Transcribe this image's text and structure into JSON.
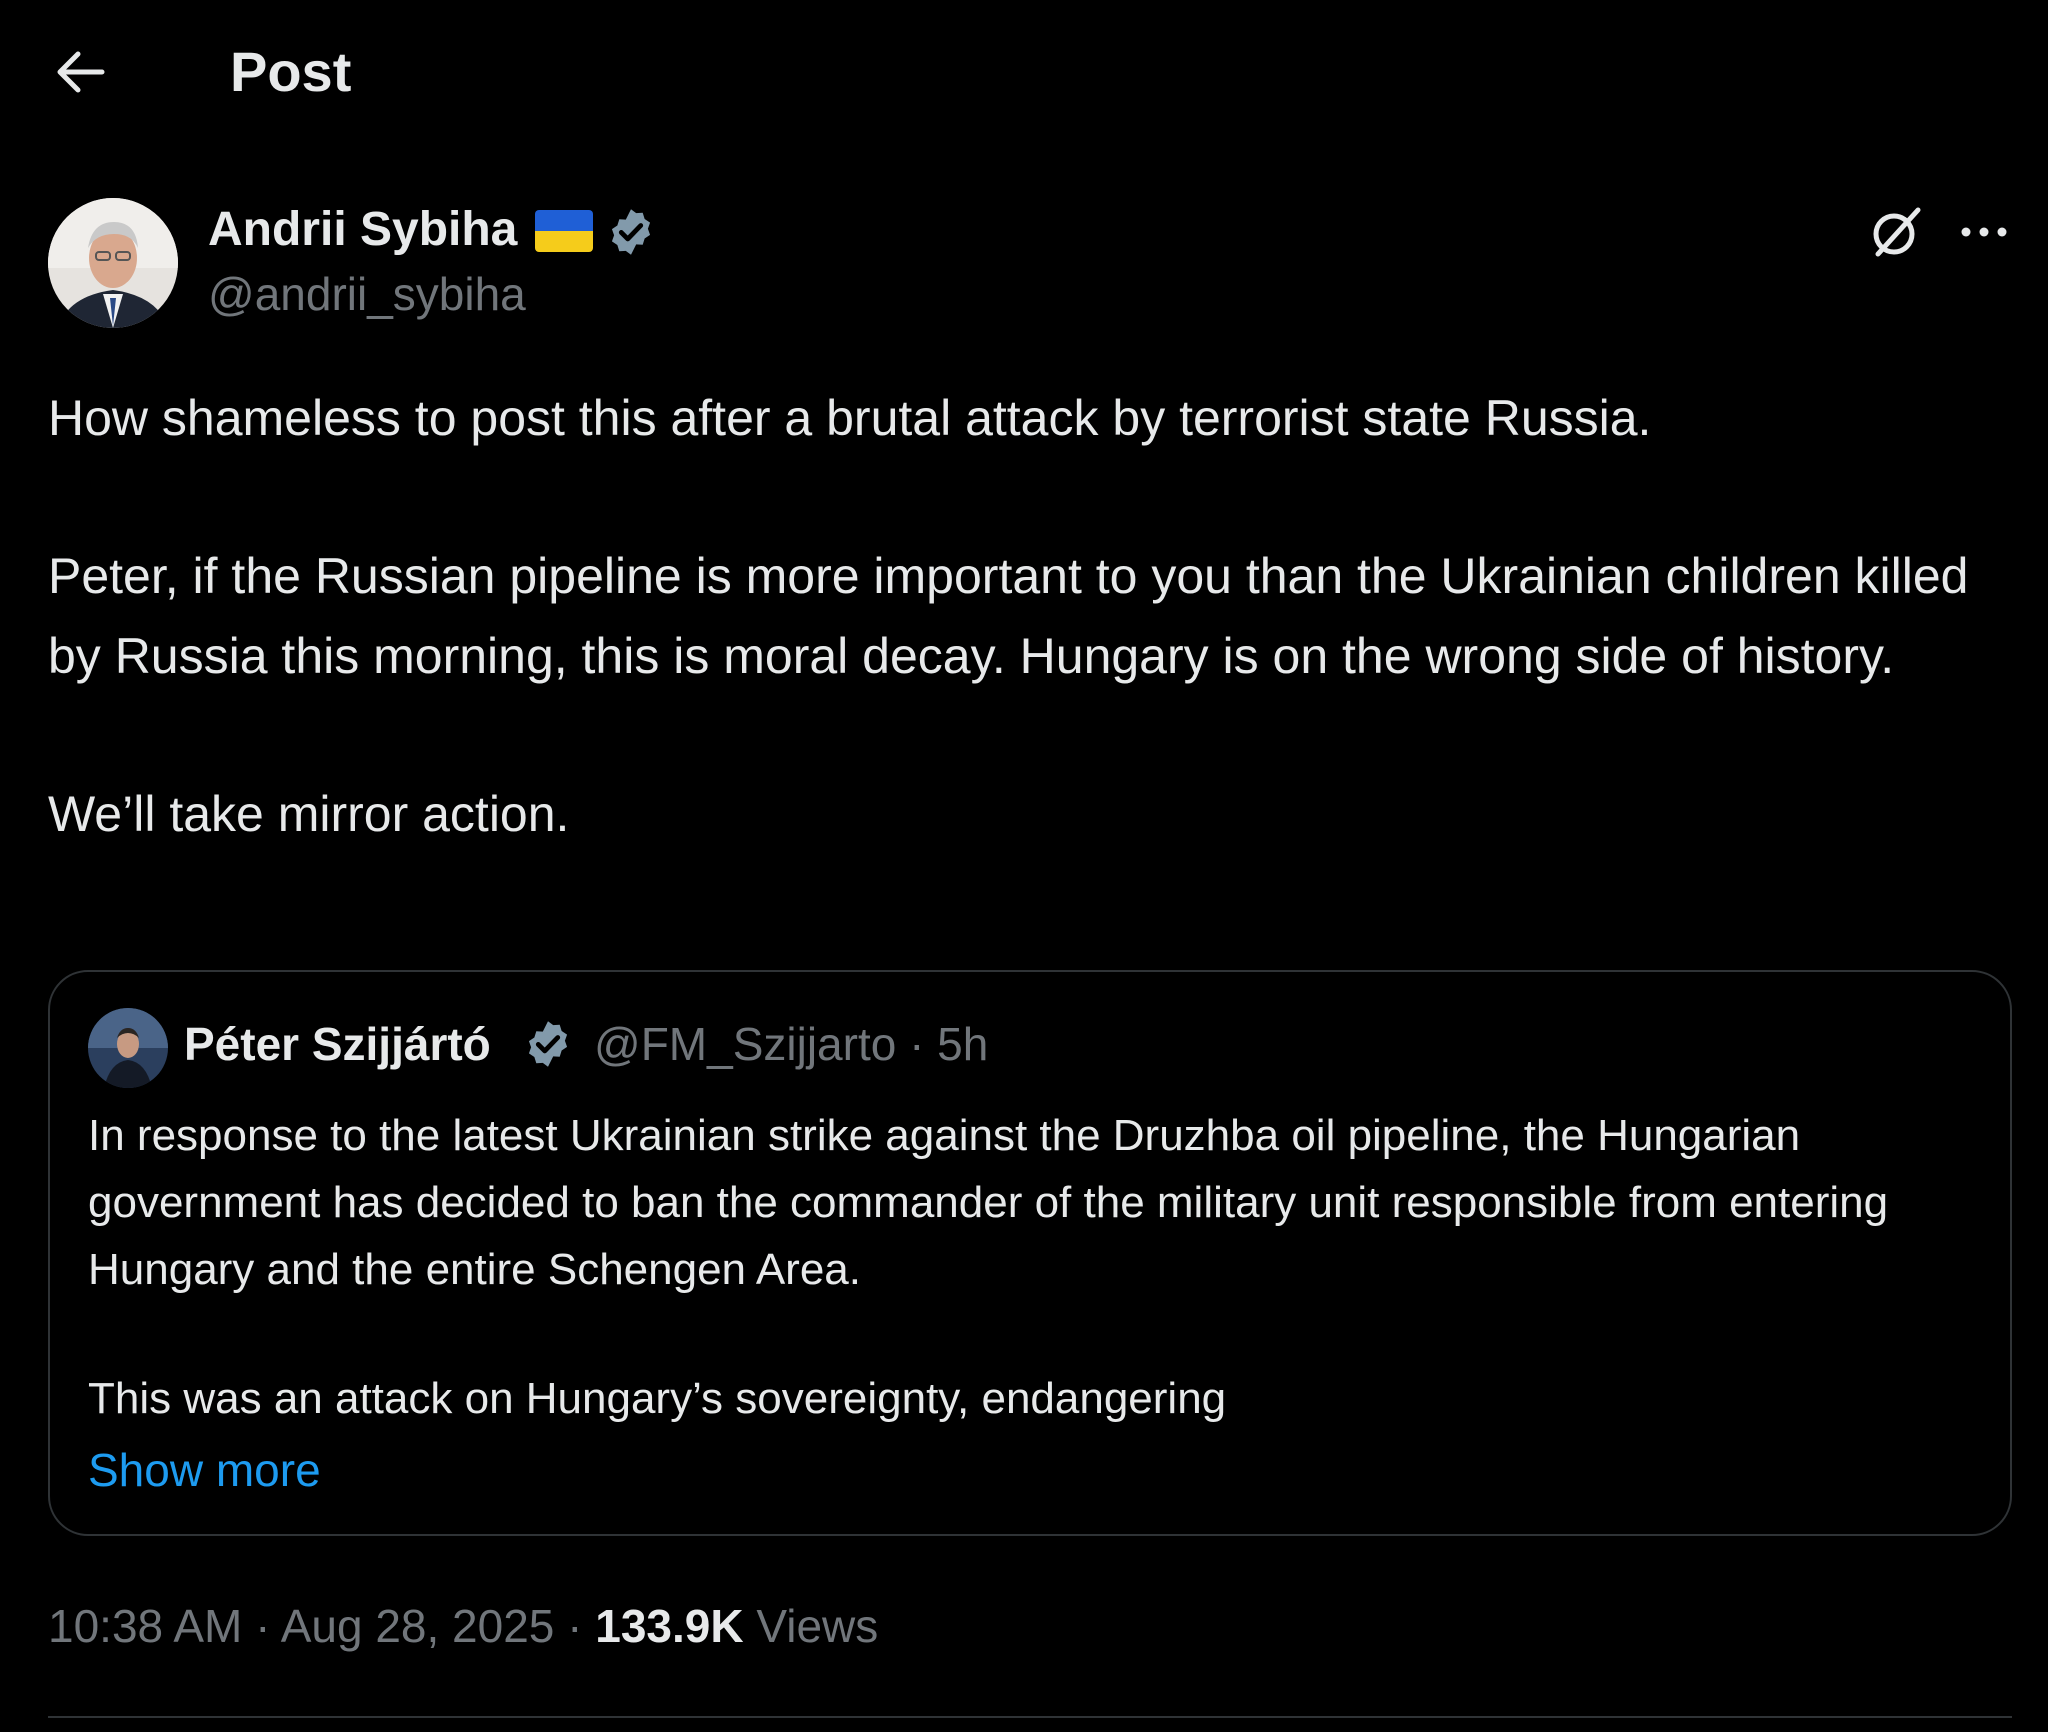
{
  "header": {
    "title": "Post"
  },
  "post": {
    "author": {
      "name": "Andrii Sybiha",
      "handle": "@andrii_sybiha"
    },
    "paragraphs": [
      "How shameless to post this after a brutal attack by terrorist state Russia.",
      "Peter, if the Russian pipeline is more important to you than the Ukrainian children killed by Russia this morning, this is moral decay. Hungary is on the wrong side of history.",
      "We’ll take mirror action."
    ],
    "quote": {
      "author_name": "Péter Szijjártó",
      "handle_time": "@FM_Szijjarto · 5h",
      "paragraphs": [
        "In response to the latest Ukrainian strike against the Druzhba oil pipeline, the Hungarian government has decided to ban the commander of the military unit responsible from entering Hungary and the entire Schengen Area.",
        "This was an attack on Hungary’s sovereignty, endangering"
      ],
      "show_more": "Show more"
    },
    "meta": {
      "timestamp": "10:38 AM · Aug 28, 2025 · ",
      "views_count": "133.9K",
      "views_label": " Views"
    }
  },
  "colors": {
    "background": "#000000",
    "text": "#e7e9ea",
    "muted": "#71767b",
    "accent": "#1d9bf0",
    "border": "#2f3336",
    "verified_badge": "#829aab"
  },
  "icons": {
    "back": "arrow-left-icon",
    "verified": "verified-badge-icon",
    "grok": "grok-icon",
    "more": "more-horizontal-icon",
    "flag": "ukraine-flag-icon"
  }
}
